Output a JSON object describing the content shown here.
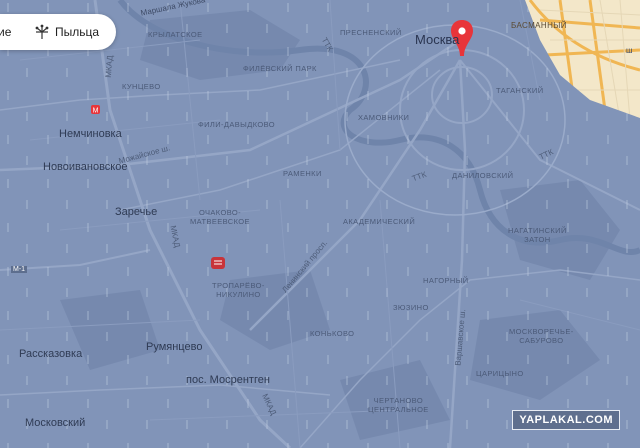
{
  "chips": {
    "left_partial": "ие",
    "pollen": "Пыльца"
  },
  "labels": {
    "moscow": "Москва",
    "marshala": "Маршала Жукова",
    "krylatskoe": "КРЫЛАТСКОЕ",
    "presnensky": "ПРЕСНЕНСКИЙ",
    "basmanny": "БАСМАННЫЙ",
    "kuntsevo": "КУНЦЕВО",
    "filevsky": "ФИЛЁВСКИЙ ПАРК",
    "fili": "ФИЛИ-ДАВЫДКОВО",
    "taganski": "ТАГАНСКИЙ",
    "nemchinovka": "Немчиновка",
    "mozhaiskoe": "Можайское ш.",
    "khamovniki": "ХАМОВНИКИ",
    "novoivanovskoe": "Новоивановское",
    "ramenki": "РАМЕНКИ",
    "ttk1": "ТТК",
    "ttk2": "ТТК",
    "ttk3": "ТТК",
    "danilovsky": "ДАНИЛОВСКИЙ",
    "zarechye": "Заречье",
    "ochakovo": "ОЧАКОВО-",
    "matveevskoe": "МАТВЕЕВСКОЕ",
    "akademichesky": "АКАДЕМИЧЕСКИЙ",
    "nagatinsky": "НАГАТИНСКИЙ",
    "zaton": "ЗАТОН",
    "mkad1": "МКАД",
    "mkad2": "МКАД",
    "mkad3": "МКАД",
    "leninsky": "Ленинский просп.",
    "m1": "М-1",
    "troparevo": "ТРОПАРЁВО-",
    "nikulino": "НИКУЛИНО",
    "nagorny": "НАГОРНЫЙ",
    "zyuzino": "ЗЮЗИНО",
    "varshavskoe": "Варшавское ш.",
    "konkovo": "КОНЬКОВО",
    "moskvorechye": "МОСКВОРЕЧЬЕ-",
    "saburovo": "САБУРОВО",
    "rasskazovka": "Рассказовка",
    "rumyantsevo": "Румянцево",
    "tsaritsyno": "ЦАРИЦЫНО",
    "mosrentgen": "пос. Мосрентген",
    "chertanovo": "ЧЕРТАНОВО",
    "tsentralnoe": "ЦЕНТРАЛЬНОЕ",
    "moskovsky": "Московский",
    "right_edge": "ш"
  },
  "watermark": "YAPLAKAL.COM",
  "colors": {
    "water": "#7d91b3",
    "land_overlay": "#8194b8",
    "orange_land": "#f3e7c9",
    "orange_road": "#f0b653",
    "pin": "#e8353a"
  },
  "icons": {
    "pin": "location-pin-icon",
    "pollen": "dandelion-icon",
    "metro": "metro-icon"
  }
}
